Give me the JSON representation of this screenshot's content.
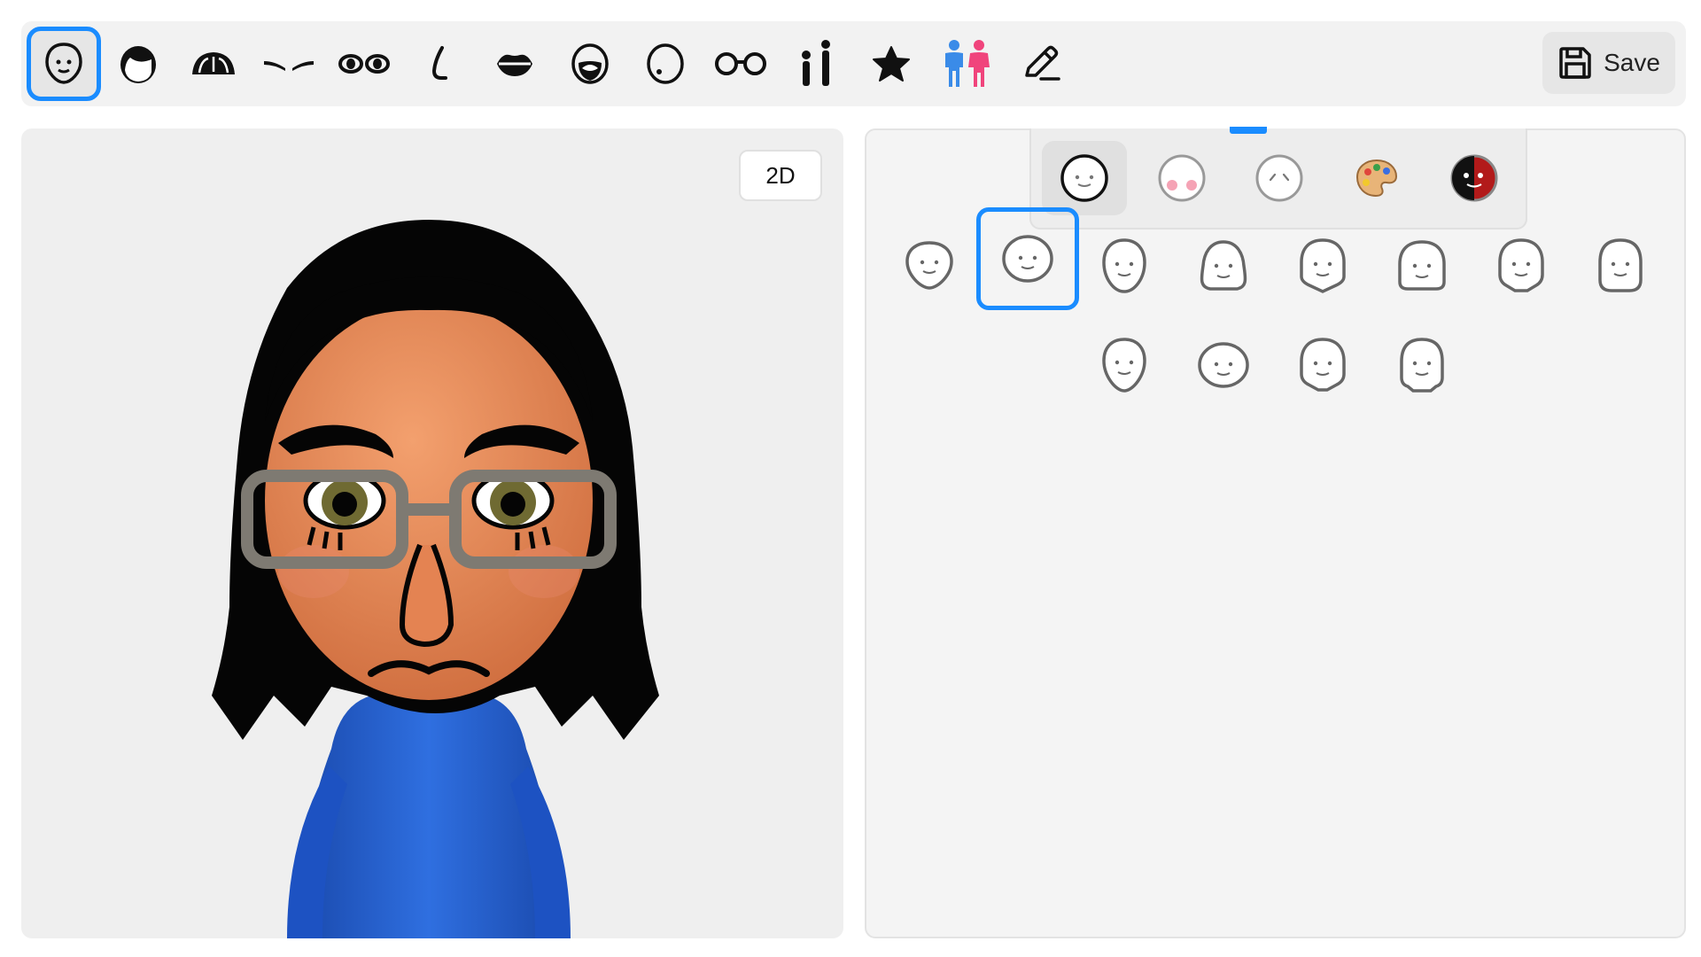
{
  "toolbar": {
    "categories": [
      {
        "name": "face-shape-icon",
        "selected": true
      },
      {
        "name": "hair-icon"
      },
      {
        "name": "hat-icon"
      },
      {
        "name": "eyebrows-icon"
      },
      {
        "name": "eyes-icon"
      },
      {
        "name": "nose-icon"
      },
      {
        "name": "mouth-icon"
      },
      {
        "name": "beard-icon"
      },
      {
        "name": "mole-icon"
      },
      {
        "name": "glasses-icon"
      },
      {
        "name": "height-icon"
      },
      {
        "name": "favorite-star-icon"
      },
      {
        "name": "gender-icon"
      },
      {
        "name": "edit-pencil-icon"
      }
    ],
    "save_label": "Save",
    "save_icon": "floppy-disk-icon"
  },
  "preview": {
    "toggle_label": "2D"
  },
  "subtabs": [
    {
      "name": "face-shape-subtab",
      "active": true
    },
    {
      "name": "makeup-subtab"
    },
    {
      "name": "wrinkles-subtab"
    },
    {
      "name": "skin-color-palette-subtab"
    },
    {
      "name": "face-color-subtab"
    }
  ],
  "face_shapes": {
    "count": 12,
    "selected_index": 1
  },
  "colors": {
    "accent": "#1a8cff",
    "skin": "#e8895a",
    "hair": "#0a0a0a",
    "shirt": "#2463d6",
    "glasses": "#7e7a72"
  }
}
